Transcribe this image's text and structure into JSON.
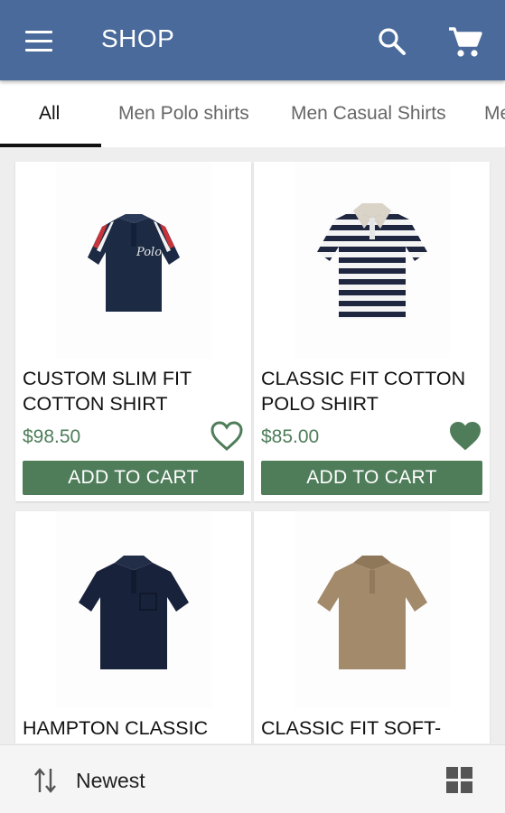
{
  "appbar": {
    "menu_icon": "menu-icon",
    "title": "SHOP",
    "search_icon": "search-icon",
    "cart_icon": "cart-icon",
    "color": "#4a6a9b"
  },
  "tabs": [
    {
      "label": "All",
      "active": true
    },
    {
      "label": "Men Polo shirts",
      "active": false
    },
    {
      "label": "Men Casual Shirts",
      "active": false
    },
    {
      "label": "Me",
      "active": false
    }
  ],
  "products": [
    {
      "name": "CUSTOM SLIM FIT COTTON SHIRT",
      "price": "$98.50",
      "favorite": false,
      "button": "ADD TO CART",
      "image": "navy-polo-red-stripes"
    },
    {
      "name": "CLASSIC FIT COTTON POLO SHIRT",
      "price": "$85.00",
      "favorite": true,
      "button": "ADD TO CART",
      "image": "striped-polo"
    },
    {
      "name": "HAMPTON CLASSIC",
      "price": "",
      "favorite": false,
      "button": "",
      "image": "navy-polo-pocket"
    },
    {
      "name": "CLASSIC FIT SOFT-",
      "price": "",
      "favorite": false,
      "button": "",
      "image": "tan-polo"
    }
  ],
  "bottombar": {
    "sort_icon": "sort-icon",
    "sort_label": "Newest",
    "view_icon": "grid-view-icon"
  },
  "colors": {
    "accent": "#4f7d5a",
    "appbar": "#4a6a9b"
  }
}
